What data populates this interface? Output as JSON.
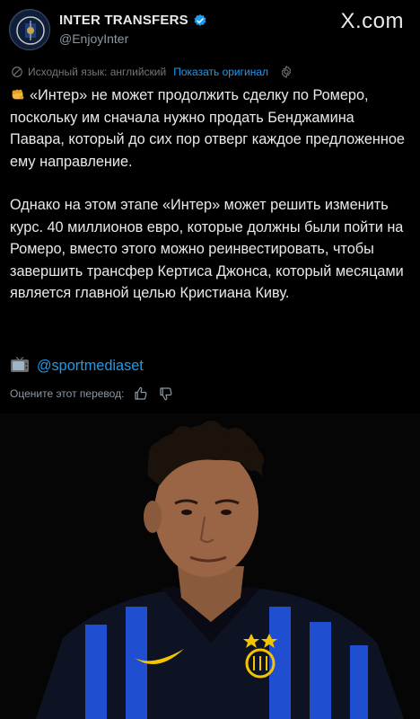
{
  "header": {
    "account_name": "INTER TRANSFERS",
    "handle": "@EnjoyInter",
    "platform_label": "X.com",
    "verified": true
  },
  "translation": {
    "source_language_text": "Исходный язык: английский",
    "show_original_label": "Показать оригинал"
  },
  "post": {
    "paragraph_1": "«Интер» не может продолжить сделку по Ромеро, поскольку им сначала нужно продать Бенджамина Павара, который до сих пор отверг каждое предложенное ему направление.",
    "paragraph_2": "Однако на этом этапе «Интер» может решить изменить курс. 40 миллионов евро, которые должны были пойти на Ромеро, вместо этого можно реинвестировать, чтобы завершить трансфер Кертиса Джонса, который месяцами является главной целью Кристиана Киву.",
    "source_mention": "@sportmediaset"
  },
  "rating": {
    "prompt": "Оцените этот перевод:"
  },
  "icons": {
    "leading_emoji": "oncoming-fist-icon",
    "source_emoji": "television-icon",
    "translate": "translate-icon",
    "settings": "gear-icon",
    "thumbs_up": "thumbs-up-icon",
    "thumbs_down": "thumbs-down-icon"
  },
  "colors": {
    "background": "#000000",
    "text": "#e7e9ea",
    "secondary_text": "#8b98a5",
    "link": "#1d9bf0",
    "verified_badge": "#1d9bf0"
  }
}
